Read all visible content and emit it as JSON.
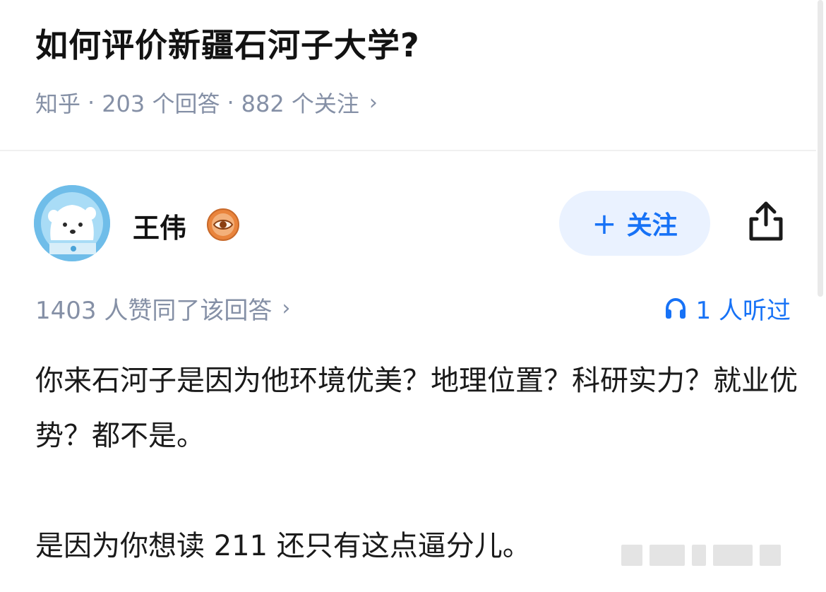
{
  "question": {
    "title": "如何评价新疆石河子大学?",
    "source": "知乎",
    "separator": "·",
    "answers": "203 个回答",
    "followers": "882 个关注",
    "chevron": "›"
  },
  "author": {
    "name": "王伟",
    "avatar_icon": "bear-avatar-icon",
    "badge_icon": "eye-badge-icon",
    "follow_label": "关注",
    "follow_plus": "+",
    "share_icon": "share-icon"
  },
  "stats": {
    "votes": "1403 人赞同了该回答",
    "chevron": "›",
    "listened": "1 人听过",
    "listen_icon": "headphones-icon"
  },
  "answer": {
    "paragraph1": "你来石河子是因为他环境优美？地理位置？科研实力？就业优势？都不是。",
    "paragraph2": "是因为你想读 211 还只有这点逼分儿。"
  },
  "colors": {
    "accent": "#1772f6",
    "muted": "#8590a6",
    "follow_bg": "#eaf2ff",
    "badge": "#e9843c"
  }
}
